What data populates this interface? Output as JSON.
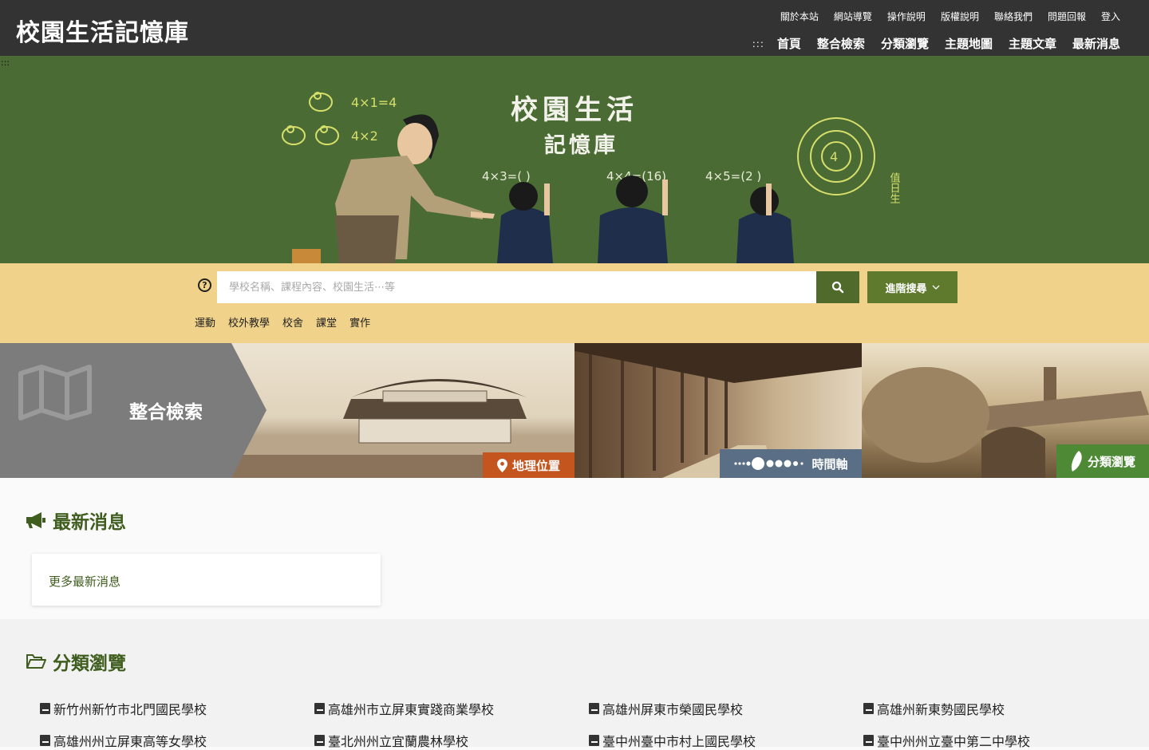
{
  "header": {
    "site_title": "校園生活記憶庫",
    "util_links": [
      "關於本站",
      "網站導覽",
      "操作說明",
      "版權說明",
      "聯絡我們",
      "問題回報",
      "登入"
    ],
    "accesskey": ":::",
    "main_links": [
      "首頁",
      "整合檢索",
      "分類瀏覽",
      "主題地圖",
      "主題文章",
      "最新消息"
    ]
  },
  "hero": {
    "accesskey": ":::",
    "title": "校園生活",
    "subtitle": "記憶庫",
    "chalk": [
      "4×1=4",
      "4×2",
      "4×3=(  )",
      "4×4=(16)",
      "4×5=(2 )",
      "值日生"
    ]
  },
  "search": {
    "placeholder": "學校名稱、課程內容、校園生活⋯等",
    "help_icon": "?",
    "advanced_label": "進階搜尋",
    "tags": [
      "運動",
      "校外教學",
      "校舍",
      "課堂",
      "實作"
    ]
  },
  "features": {
    "panel_title": "整合檢索",
    "geo_label": "地理位置",
    "time_label": "時間軸",
    "category_label": "分類瀏覽"
  },
  "news": {
    "title": "最新消息",
    "more_label": "更多最新消息"
  },
  "categories": {
    "title": "分類瀏覽",
    "items": [
      "新竹州新竹市北門國民學校",
      "高雄州市立屏東實踐商業學校",
      "高雄州屏東市榮國民學校",
      "高雄州新東勢國民學校",
      "高雄州州立屏東高等女學校",
      "臺北州州立宜蘭農林學校",
      "臺中州臺中市村上國民學校",
      "臺中州州立臺中第二中學校"
    ]
  },
  "colors": {
    "header_bg": "#333333",
    "chalkboard": "#4b6b35",
    "search_band": "#f0d28a",
    "accent_green": "#4f6a2a",
    "geo_badge": "#c5551f",
    "time_badge": "#5a6f86",
    "category_badge": "#4e8a35"
  }
}
